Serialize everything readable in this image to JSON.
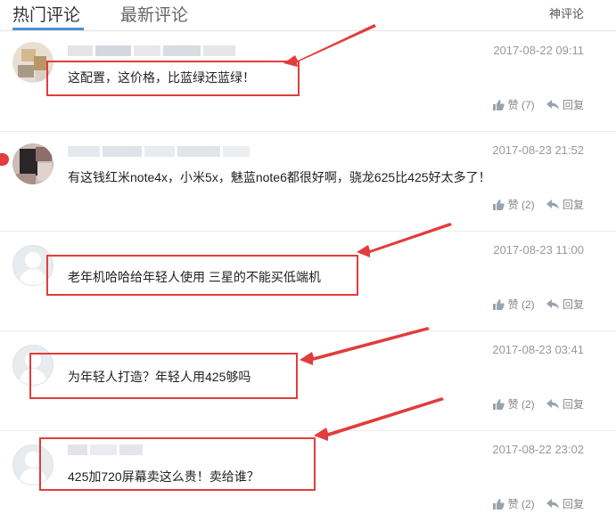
{
  "tabs": {
    "hot": "热门评论",
    "latest": "最新评论"
  },
  "god_comment_link": "神评论",
  "comments": [
    {
      "time": "2017-08-22 09:11",
      "text": "这配置，这价格，比蓝绿还蓝绿！",
      "likes": "赞 (7)",
      "reply": "回复"
    },
    {
      "time": "2017-08-23 21:52",
      "text": "有这钱红米note4x，小米5x，魅蓝note6都很好啊，骁龙625比425好太多了！",
      "likes": "赞 (2)",
      "reply": "回复"
    },
    {
      "time": "2017-08-23 11:00",
      "text": "老年机哈哈给年轻人使用 三星的不能买低端机",
      "likes": "赞 (2)",
      "reply": "回复"
    },
    {
      "time": "2017-08-23 03:41",
      "text": "为年轻人打造？年轻人用425够吗",
      "likes": "赞 (2)",
      "reply": "回复"
    },
    {
      "time": "2017-08-22 23:02",
      "text": "425加720屏幕卖这么贵！卖给谁？",
      "likes": "赞 (2)",
      "reply": "回复"
    }
  ],
  "colors": {
    "accent": "#4f8fd9",
    "annotation": "#e23c3c"
  }
}
